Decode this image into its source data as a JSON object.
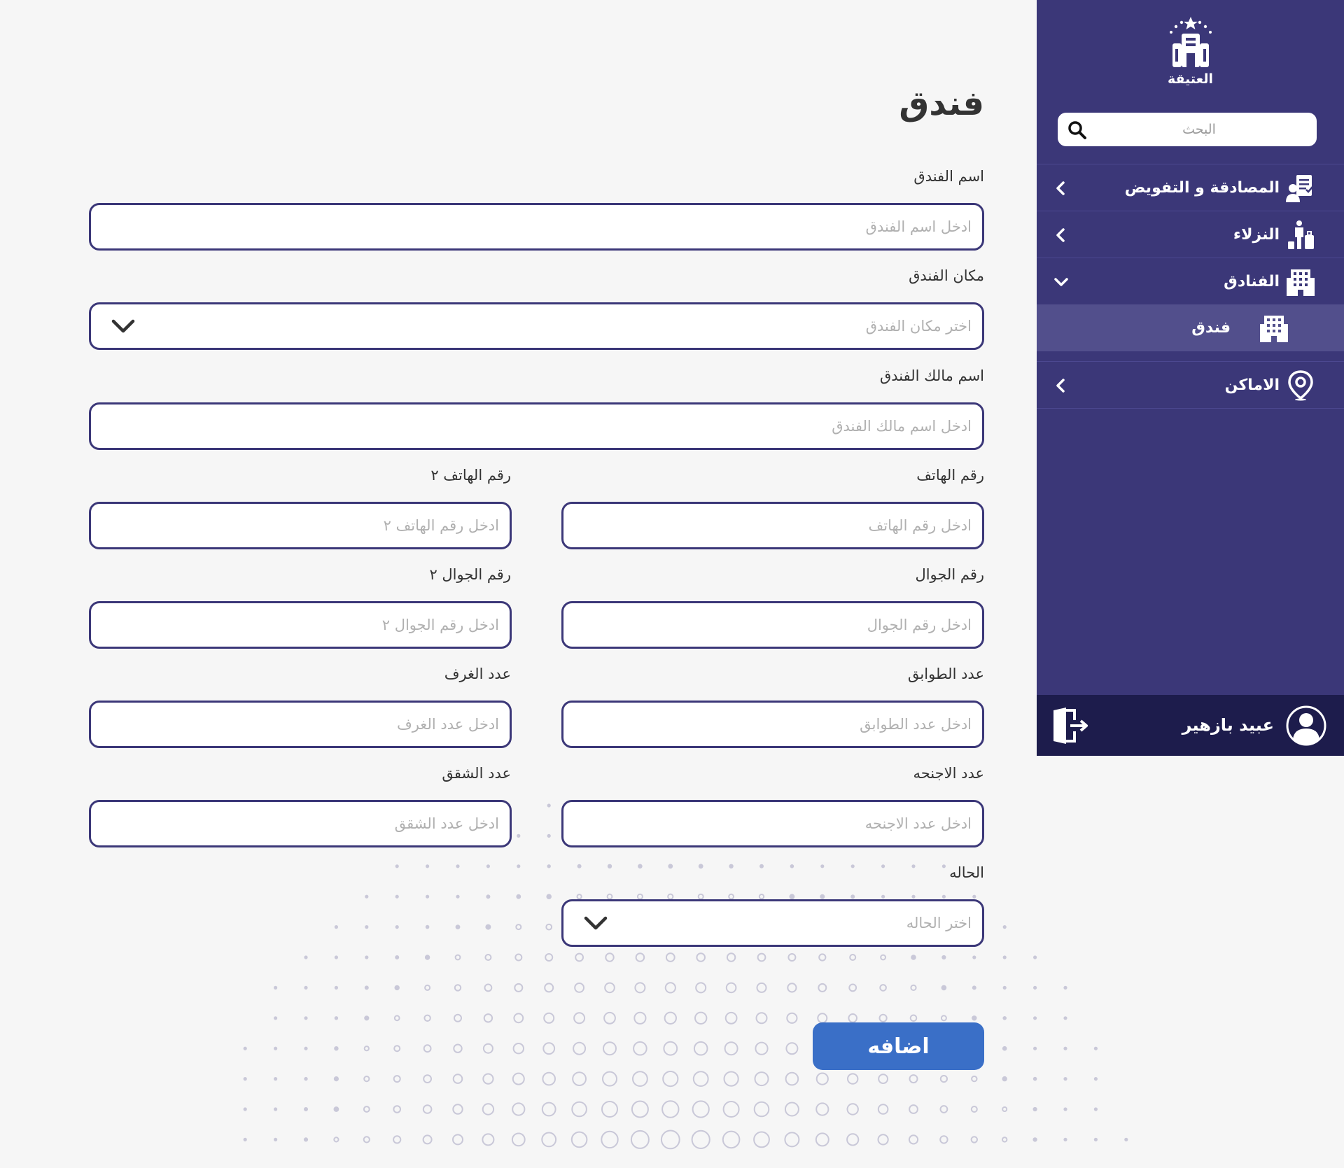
{
  "sidebar": {
    "logo_text": "العتيقة",
    "search_placeholder": "البحث",
    "nav": [
      {
        "label": "المصادقة و التفويض"
      },
      {
        "label": "النزلاء"
      },
      {
        "label": "الفنادق",
        "sub": [
          {
            "label": "فندق"
          }
        ]
      },
      {
        "label": "الاماكن"
      }
    ],
    "user": {
      "name": "عبيد بازهير"
    }
  },
  "form": {
    "title": "فندق",
    "hotel_name": {
      "label": "اسم الفندق",
      "placeholder": "ادخل اسم الفندق"
    },
    "hotel_location": {
      "label": "مكان الفندق",
      "placeholder": "اختر مكان الفندق"
    },
    "owner_name": {
      "label": "اسم مالك الفندق",
      "placeholder": "ادخل اسم مالك الفندق"
    },
    "phone": {
      "label": "رقم الهاتف",
      "placeholder": "ادخل رقم الهاتف"
    },
    "phone2": {
      "label": "رقم الهاتف ٢",
      "placeholder": "ادخل رقم الهاتف ٢"
    },
    "mobile": {
      "label": "رقم الجوال",
      "placeholder": "ادخل رقم الجوال"
    },
    "mobile2": {
      "label": "رقم الجوال ٢",
      "placeholder": "ادخل رقم الجوال ٢"
    },
    "floors": {
      "label": "عدد الطوابق",
      "placeholder": "ادخل عدد الطوابق"
    },
    "rooms": {
      "label": "عدد الغرف",
      "placeholder": "ادخل عدد الغرف"
    },
    "suites": {
      "label": "عدد الاجنحه",
      "placeholder": "ادخل عدد الاجنحه"
    },
    "apartments": {
      "label": "عدد الشقق",
      "placeholder": "ادخل عدد الشقق"
    },
    "status": {
      "label": "الحاله",
      "placeholder": "اختر الحاله"
    },
    "submit_label": "اضافه"
  },
  "colors": {
    "sidebar_bg": "#3b3778",
    "sidebar_active": "#524f8c",
    "userbar_bg": "#1d1c4c",
    "field_border": "#3b3778",
    "button_bg": "#3a6fc7",
    "page_bg": "#f6f6f6"
  }
}
